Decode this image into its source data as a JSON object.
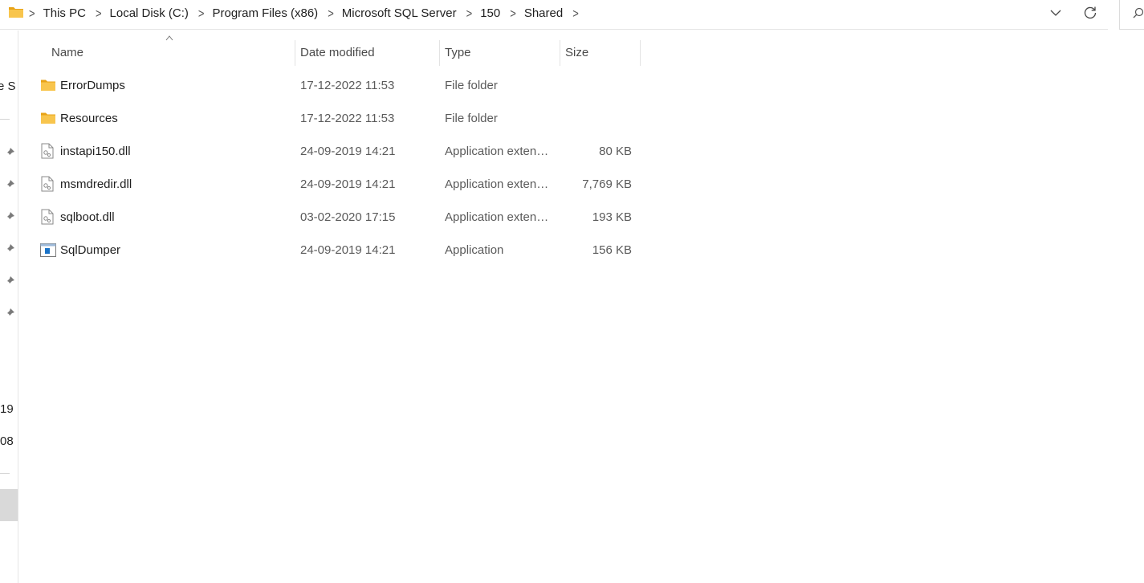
{
  "breadcrumb": [
    "This PC",
    "Local Disk (C:)",
    "Program Files (x86)",
    "Microsoft SQL Server",
    "150",
    "Shared"
  ],
  "columns": {
    "name": "Name",
    "date": "Date modified",
    "type": "Type",
    "size": "Size"
  },
  "files": [
    {
      "name": "ErrorDumps",
      "date": "17-12-2022 11:53",
      "type": "File folder",
      "size": "",
      "icon": "folder-icon"
    },
    {
      "name": "Resources",
      "date": "17-12-2022 11:53",
      "type": "File folder",
      "size": "",
      "icon": "folder-icon"
    },
    {
      "name": "instapi150.dll",
      "date": "24-09-2019 14:21",
      "type": "Application extension",
      "size": "80 KB",
      "icon": "dll-file-icon"
    },
    {
      "name": "msmdredir.dll",
      "date": "24-09-2019 14:21",
      "type": "Application extension",
      "size": "7,769 KB",
      "icon": "dll-file-icon"
    },
    {
      "name": "sqlboot.dll",
      "date": "03-02-2020 17:15",
      "type": "Application extension",
      "size": "193 KB",
      "icon": "dll-file-icon"
    },
    {
      "name": "SqlDumper",
      "date": "24-09-2019 14:21",
      "type": "Application",
      "size": "156 KB",
      "icon": "application-icon"
    }
  ],
  "nav": {
    "clipped_item_1": "re S",
    "clipped_item_2": "19",
    "clipped_item_3": "08"
  },
  "colors": {
    "folder": "#F8C54D",
    "folder_dark": "#E8A317",
    "app_blue": "#1A73C8",
    "selected_nav": "#D9D9D9"
  }
}
